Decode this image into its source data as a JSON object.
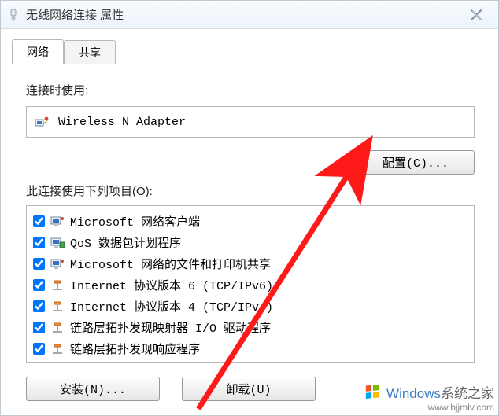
{
  "window": {
    "title": "无线网络连接 属性"
  },
  "tabs": {
    "network": "网络",
    "sharing": "共享"
  },
  "labels": {
    "connect_using": "连接时使用:",
    "items_label": "此连接使用下列项目(O):"
  },
  "adapter": {
    "name": "Wireless N Adapter"
  },
  "buttons": {
    "configure": "配置(C)...",
    "install": "安装(N)...",
    "uninstall": "卸载(U)"
  },
  "items": [
    {
      "checked": true,
      "icon": "client",
      "label": "Microsoft 网络客户端"
    },
    {
      "checked": true,
      "icon": "qos",
      "label": "QoS 数据包计划程序"
    },
    {
      "checked": true,
      "icon": "client",
      "label": "Microsoft 网络的文件和打印机共享"
    },
    {
      "checked": true,
      "icon": "protocol",
      "label": "Internet 协议版本 6 (TCP/IPv6)"
    },
    {
      "checked": true,
      "icon": "protocol",
      "label": "Internet 协议版本 4 (TCP/IPv4)"
    },
    {
      "checked": true,
      "icon": "protocol",
      "label": "链路层拓扑发现映射器 I/O 驱动程序"
    },
    {
      "checked": true,
      "icon": "protocol",
      "label": "链路层拓扑发现响应程序"
    }
  ],
  "watermark": {
    "brand": "Windows",
    "sub": "系统之家",
    "url": "www.bjjmlv.com"
  }
}
